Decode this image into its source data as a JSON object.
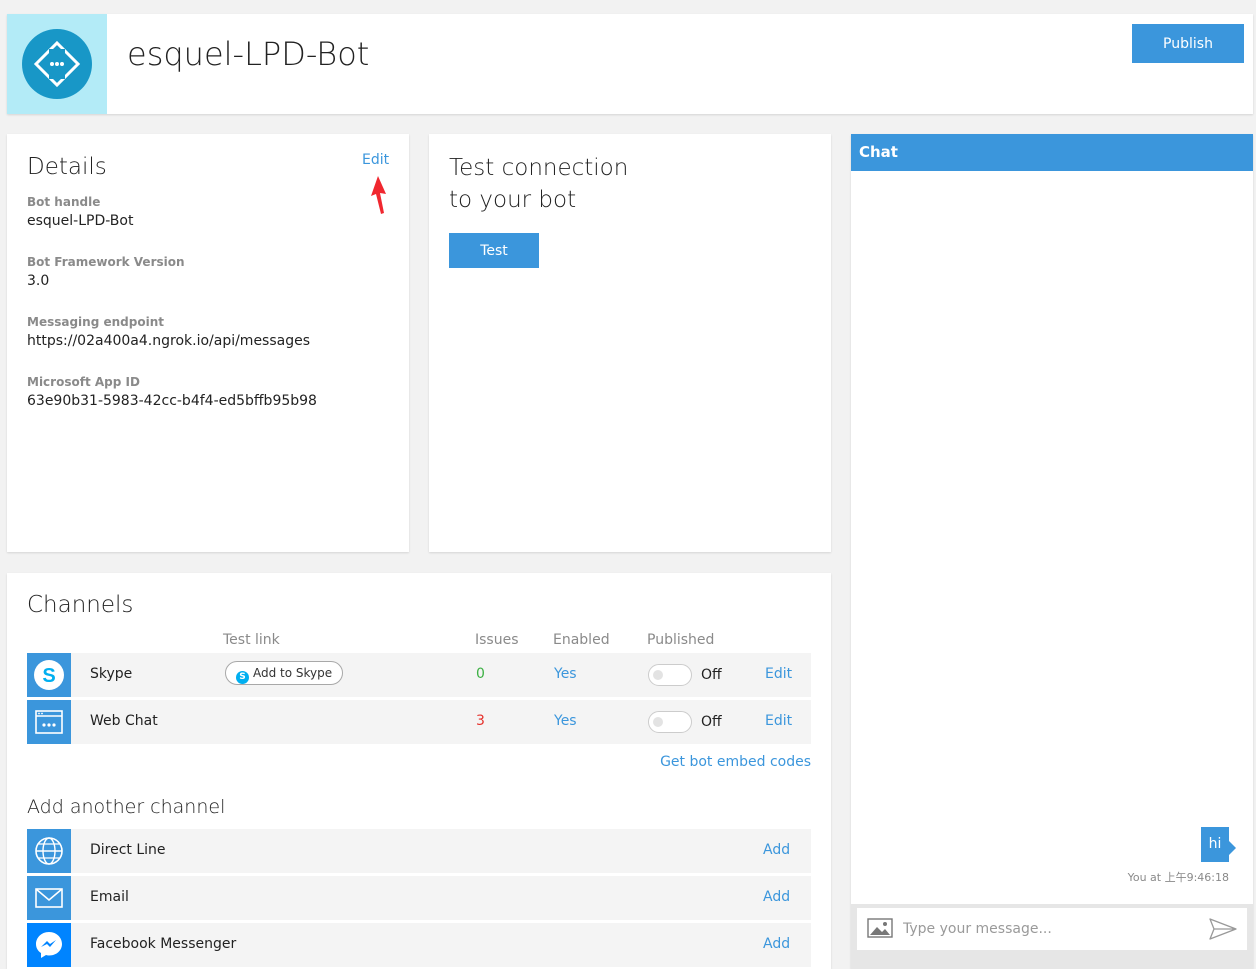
{
  "header": {
    "bot_name": "esquel-LPD-Bot",
    "publish_label": "Publish"
  },
  "details": {
    "title": "Details",
    "edit_label": "Edit",
    "fields": [
      {
        "label": "Bot handle",
        "value": "esquel-LPD-Bot"
      },
      {
        "label": "Bot Framework Version",
        "value": "3.0"
      },
      {
        "label": "Messaging endpoint",
        "value": "https://02a400a4.ngrok.io/api/messages"
      },
      {
        "label": "Microsoft App ID",
        "value": "63e90b31-5983-42cc-b4f4-ed5bffb95b98"
      }
    ]
  },
  "test_connection": {
    "title_line1": "Test connection",
    "title_line2": "to your bot",
    "test_label": "Test"
  },
  "channels": {
    "title": "Channels",
    "columns": {
      "test_link": "Test link",
      "issues": "Issues",
      "enabled": "Enabled",
      "published": "Published"
    },
    "rows": [
      {
        "name": "Skype",
        "test_link": "Add to Skype",
        "issues": "0",
        "issues_color": "#3cb043",
        "enabled": "Yes",
        "published": "Off",
        "edit": "Edit",
        "icon": "skype-icon"
      },
      {
        "name": "Web Chat",
        "test_link": "",
        "issues": "3",
        "issues_color": "#e5322d",
        "enabled": "Yes",
        "published": "Off",
        "edit": "Edit",
        "icon": "web-chat-icon"
      }
    ],
    "embed_link": "Get bot embed codes",
    "add_title": "Add another channel",
    "add_rows": [
      {
        "name": "Direct Line",
        "action": "Add",
        "icon": "globe-icon"
      },
      {
        "name": "Email",
        "action": "Add",
        "icon": "envelope-icon"
      },
      {
        "name": "Facebook Messenger",
        "action": "Add",
        "icon": "messenger-icon"
      }
    ]
  },
  "chat": {
    "title": "Chat",
    "message": "hi",
    "timestamp": "You at 上午9:46:18",
    "placeholder": "Type your message..."
  },
  "colors": {
    "accent": "#3b96dc",
    "bot_icon_bg": "#b3ebf7",
    "bot_icon_circle": "#1897c7",
    "skype": "#00aff0",
    "messenger": "#0084ff"
  }
}
